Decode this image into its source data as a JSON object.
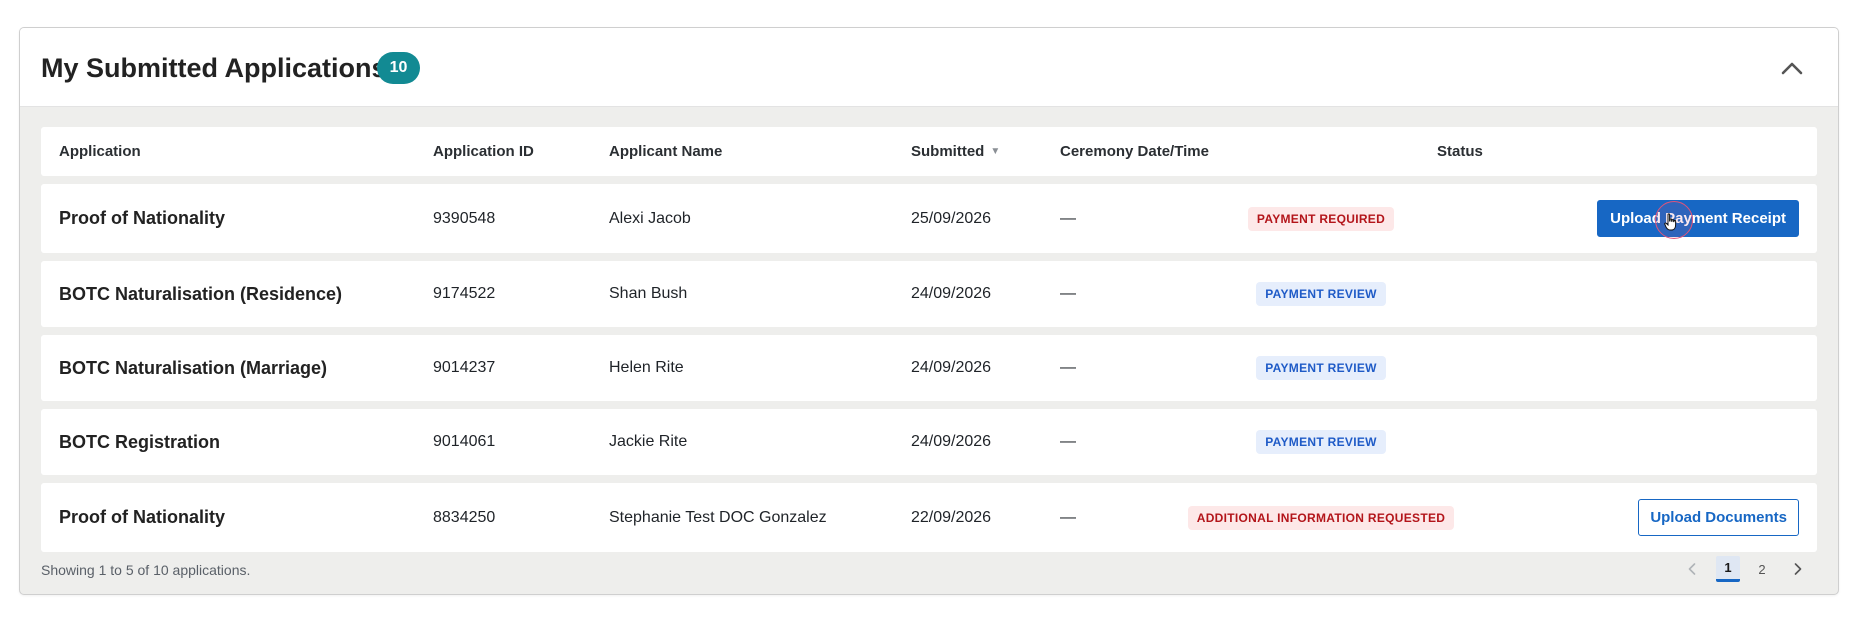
{
  "panel": {
    "title": "My Submitted Applications",
    "count": "10"
  },
  "table": {
    "columns": {
      "application": "Application",
      "application_id": "Application ID",
      "applicant_name": "Applicant Name",
      "submitted": "Submitted",
      "ceremony": "Ceremony Date/Time",
      "status": "Status"
    },
    "sort": {
      "column": "submitted",
      "direction": "desc"
    },
    "rows": [
      {
        "application": "Proof of Nationality",
        "id": "9390548",
        "name": "Alexi Jacob",
        "submitted": "25/09/2026",
        "ceremony": "—",
        "status": "PAYMENT REQUIRED",
        "action": "Upload Payment Receipt"
      },
      {
        "application": "BOTC Naturalisation (Residence)",
        "id": "9174522",
        "name": "Shan Bush",
        "submitted": "24/09/2026",
        "ceremony": "—",
        "status": "PAYMENT REVIEW",
        "action": ""
      },
      {
        "application": "BOTC Naturalisation (Marriage)",
        "id": "9014237",
        "name": "Helen Rite",
        "submitted": "24/09/2026",
        "ceremony": "—",
        "status": "PAYMENT REVIEW",
        "action": ""
      },
      {
        "application": "BOTC Registration",
        "id": "9014061",
        "name": "Jackie Rite",
        "submitted": "24/09/2026",
        "ceremony": "—",
        "status": "PAYMENT REVIEW",
        "action": ""
      },
      {
        "application": "Proof of Nationality",
        "id": "8834250",
        "name": "Stephanie Test DOC Gonzalez",
        "submitted": "22/09/2026",
        "ceremony": "—",
        "status": "ADDITIONAL INFORMATION REQUESTED",
        "action": "Upload Documents"
      }
    ]
  },
  "footer": {
    "showing": "Showing 1 to 5 of 10 applications.",
    "pages": [
      "1",
      "2"
    ],
    "current_page": "1"
  },
  "colors": {
    "accent": "#1767c4",
    "badge": "#128a93",
    "status_red_bg": "#fde8e8",
    "status_red_text": "#b3151a",
    "status_blue_bg": "#e6eefc",
    "status_blue_text": "#1f5bc7"
  },
  "icons": {
    "collapse": "chevron-up-icon",
    "sort": "sort-desc-icon",
    "prev": "chevron-left-icon",
    "next": "chevron-right-icon",
    "cursor": "hand-pointer-icon"
  }
}
